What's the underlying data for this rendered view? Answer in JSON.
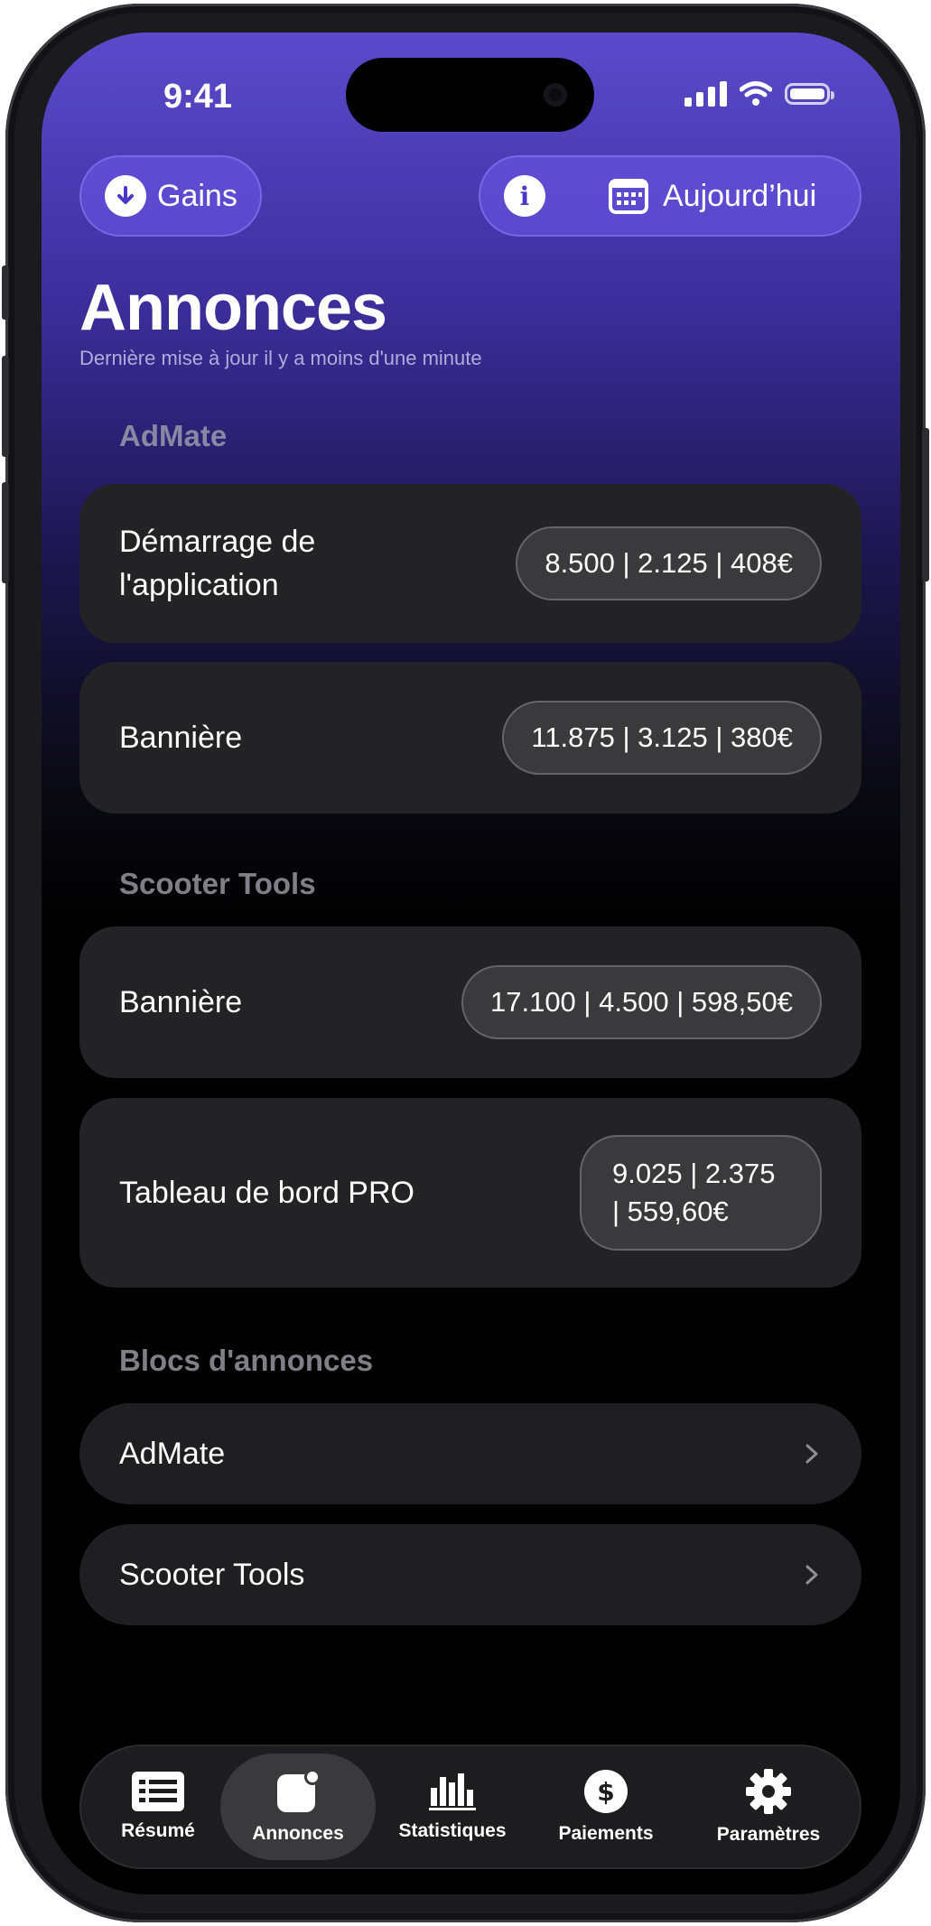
{
  "status": {
    "time": "9:41"
  },
  "header": {
    "gains_label": "Gains",
    "info_icon": "info-icon",
    "date_label": "Aujourd’hui"
  },
  "page": {
    "title": "Annonces",
    "subtitle": "Dernière mise à jour il y a moins d'une minute"
  },
  "sections": [
    {
      "title": "AdMate",
      "items": [
        {
          "label": "Démarrage de l'application",
          "value": "8.500 | 2.125 | 408€"
        },
        {
          "label": "Bannière",
          "value": "11.875 | 3.125 | 380€"
        }
      ]
    },
    {
      "title": "Scooter Tools",
      "items": [
        {
          "label": "Bannière",
          "value": "17.100 | 4.500 | 598,50€"
        },
        {
          "label": "Tableau de bord PRO",
          "value": "9.025 | 2.375 | 559,60€"
        }
      ]
    }
  ],
  "ad_units": {
    "title": "Blocs d'annonces",
    "items": [
      {
        "label": "AdMate"
      },
      {
        "label": "Scooter Tools"
      }
    ]
  },
  "tabs": [
    {
      "label": "Résumé",
      "icon": "list-icon"
    },
    {
      "label": "Annonces",
      "icon": "app-badge-icon",
      "active": true
    },
    {
      "label": "Statistiques",
      "icon": "bar-chart-icon"
    },
    {
      "label": "Paiements",
      "icon": "dollar-icon"
    },
    {
      "label": "Paramètres",
      "icon": "gear-icon"
    }
  ],
  "colors": {
    "accent": "#5b4bcc",
    "card": "#232325",
    "background": "#000000"
  }
}
